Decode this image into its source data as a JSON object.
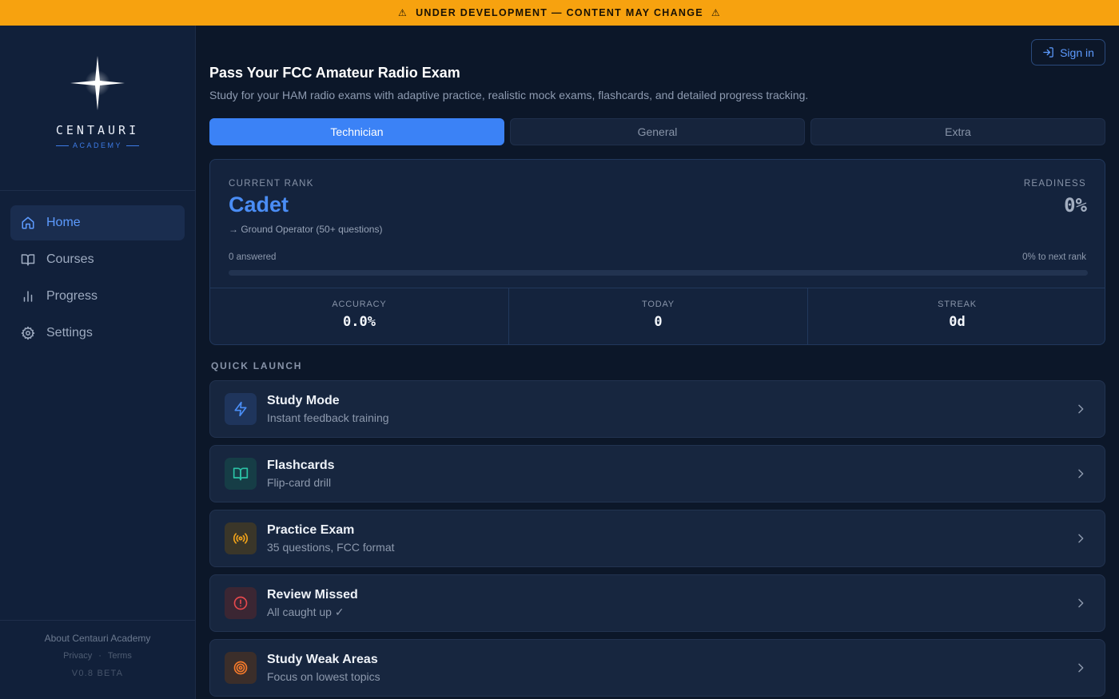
{
  "banner": {
    "text": "UNDER DEVELOPMENT — CONTENT MAY CHANGE",
    "icon_left": "⚠",
    "icon_right": "⚠",
    "color": "#f7a20f"
  },
  "brand": {
    "name": "CENTAURI",
    "tagline": "ACADEMY",
    "logo_icon": "four-point-star-icon"
  },
  "sidebar": {
    "items": [
      {
        "label": "Home",
        "icon": "home-icon",
        "active": true
      },
      {
        "label": "Courses",
        "icon": "book-open-icon",
        "active": false
      },
      {
        "label": "Progress",
        "icon": "bar-chart-icon",
        "active": false
      },
      {
        "label": "Settings",
        "icon": "gear-icon",
        "active": false
      }
    ],
    "footer": {
      "about": "About Centauri Academy",
      "privacy": "Privacy",
      "separator": "·",
      "terms": "Terms",
      "version": "V0.8 BETA"
    }
  },
  "header": {
    "signin_label": "Sign in",
    "title": "Pass Your FCC Amateur Radio Exam",
    "subtitle": "Study for your HAM radio exams with adaptive practice, realistic mock exams, flashcards, and detailed progress tracking."
  },
  "tabs": [
    {
      "label": "Technician",
      "active": true
    },
    {
      "label": "General",
      "active": false
    },
    {
      "label": "Extra",
      "active": false
    }
  ],
  "rank": {
    "current_rank_label": "CURRENT RANK",
    "current_rank": "Cadet",
    "next_rank": "→ Ground Operator (50+ questions)",
    "readiness_label": "READINESS",
    "readiness": "0%",
    "answered": "0 answered",
    "to_next": "0% to next rank",
    "progress_fraction": 0
  },
  "stats": [
    {
      "label": "ACCURACY",
      "value": "0.0%"
    },
    {
      "label": "TODAY",
      "value": "0"
    },
    {
      "label": "STREAK",
      "value": "0d"
    }
  ],
  "quick_launch": {
    "heading": "QUICK LAUNCH",
    "items": [
      {
        "title": "Study Mode",
        "desc": "Instant feedback training",
        "icon": "lightning-icon",
        "color": "#4a8df5",
        "bg": "#1f355c"
      },
      {
        "title": "Flashcards",
        "desc": "Flip-card drill",
        "icon": "book-open-icon",
        "color": "#2bc2a6",
        "bg": "#163d46"
      },
      {
        "title": "Practice Exam",
        "desc": "35 questions, FCC format",
        "icon": "radio-broadcast-icon",
        "color": "#f0a21a",
        "bg": "#3a3629"
      },
      {
        "title": "Review Missed",
        "desc": "All caught up ✓",
        "icon": "alert-circle-icon",
        "color": "#e5484d",
        "bg": "#3b2633"
      },
      {
        "title": "Study Weak Areas",
        "desc": "Focus on lowest topics",
        "icon": "target-icon",
        "color": "#f57a2a",
        "bg": "#3b2e2a"
      }
    ]
  },
  "colors": {
    "accent": "#3b82f6",
    "background": "#0c1729",
    "sidebar": "#11203a",
    "card": "#14233d"
  }
}
